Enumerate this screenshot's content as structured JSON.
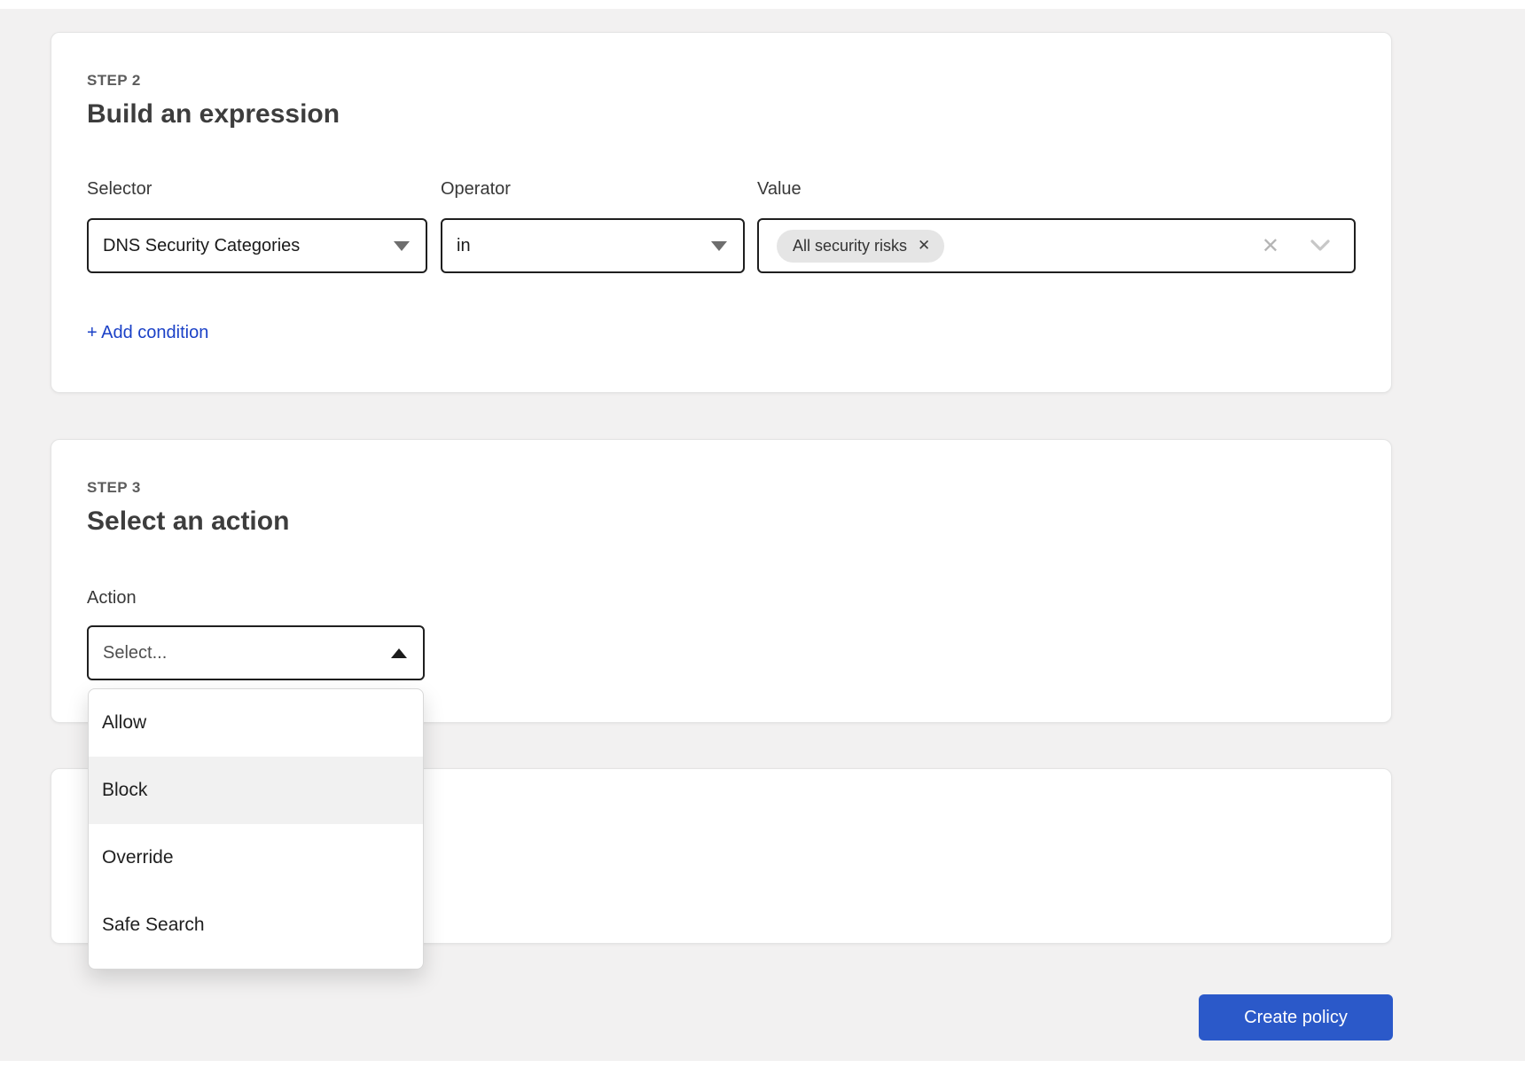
{
  "colors": {
    "page_background": "#f2f1f1",
    "link_blue": "#1b41c7",
    "button_blue": "#2b59c9",
    "highlight_gray": "#f1f1f1",
    "tag_gray": "#e5e5e5"
  },
  "step2": {
    "step_label": "STEP 2",
    "title": "Build an expression",
    "selector": {
      "label": "Selector",
      "value": "DNS Security Categories"
    },
    "operator": {
      "label": "Operator",
      "value": "in"
    },
    "value": {
      "label": "Value",
      "tags": [
        {
          "label": "All security risks"
        }
      ]
    },
    "add_condition_label": "+ Add condition"
  },
  "step3": {
    "step_label": "STEP 3",
    "title": "Select an action",
    "action": {
      "label": "Action",
      "placeholder": "Select...",
      "options": [
        {
          "label": "Allow"
        },
        {
          "label": "Block"
        },
        {
          "label": "Override"
        },
        {
          "label": "Safe Search"
        }
      ],
      "highlighted_option": "Block"
    }
  },
  "footer": {
    "create_button_label": "Create policy"
  },
  "icons": {
    "remove_x": "✕",
    "clear_x": "✕"
  }
}
